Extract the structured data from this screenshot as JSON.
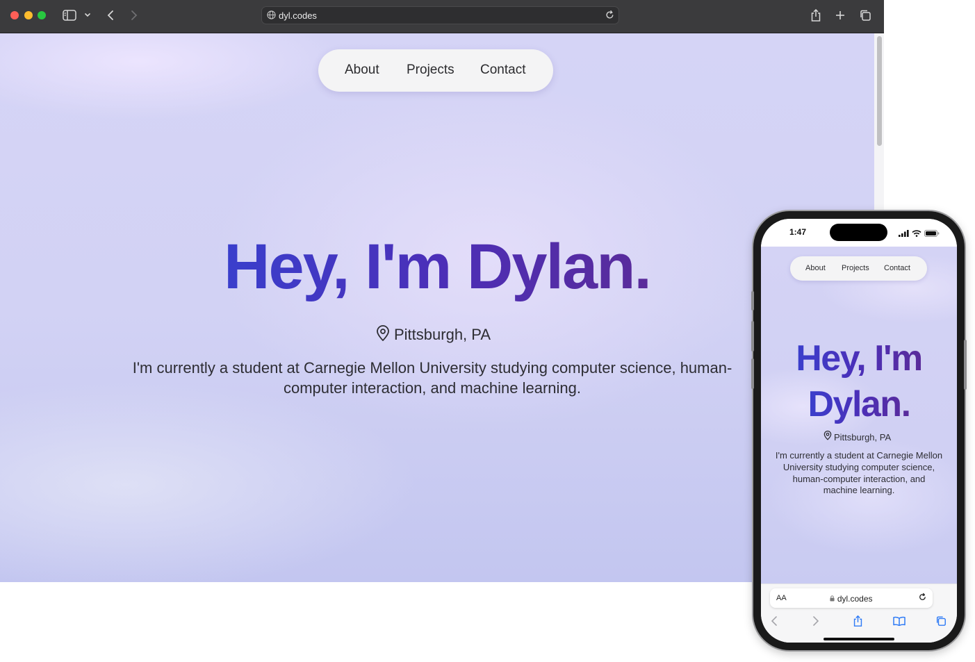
{
  "browser": {
    "url": "dyl.codes",
    "icons": [
      "sidebar-icon",
      "chevron-down-icon",
      "back-icon",
      "forward-icon",
      "globe-icon",
      "reload-icon",
      "share-icon",
      "new-tab-icon",
      "tabs-overview-icon"
    ]
  },
  "site": {
    "nav": [
      "About",
      "Projects",
      "Contact"
    ],
    "title": "Hey, I'm Dylan.",
    "mobile_title_line1": "Hey, I'm",
    "mobile_title_line2": "Dylan.",
    "location": "Pittsburgh, PA",
    "bio": "I'm currently a student at Carnegie Mellon University studying computer science, human-computer interaction, and machine learning.",
    "colors": {
      "title_gradient_start": "#3a3fcc",
      "title_gradient_end": "#5a2b9a",
      "background": "#d2d2f4",
      "nav_background": "#f4f4f5"
    }
  },
  "phone": {
    "time": "1:47",
    "aa_label": "AA",
    "url": "dyl.codes",
    "icons": [
      "signal-icon",
      "wifi-icon",
      "battery-icon",
      "lock-icon",
      "reload-icon",
      "back-icon",
      "forward-icon",
      "share-icon",
      "bookmarks-icon",
      "tabs-icon"
    ]
  }
}
